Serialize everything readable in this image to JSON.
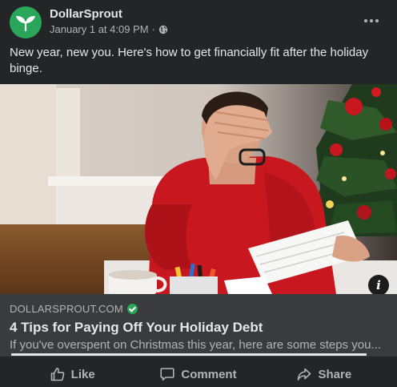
{
  "post": {
    "page_name": "DollarSprout",
    "timestamp": "January 1 at 4:09 PM",
    "separator": "·",
    "privacy_icon": "globe-icon",
    "more_icon": "more-options-icon",
    "text": "New year, new you. Here's how to get financially fit after the holiday binge."
  },
  "link_preview": {
    "domain": "DOLLARSPROUT.COM",
    "title": "4 Tips for Paying Off Your Holiday Debt",
    "description": "If you've overspent on Christmas this year, here are some steps you...",
    "progress": 1.0
  },
  "actions": {
    "like": "Like",
    "comment": "Comment",
    "share": "Share"
  },
  "colors": {
    "background": "#242526",
    "card": "#3a3b3c",
    "brand_green": "#2aa65b",
    "sweater_red": "#c8171f"
  }
}
